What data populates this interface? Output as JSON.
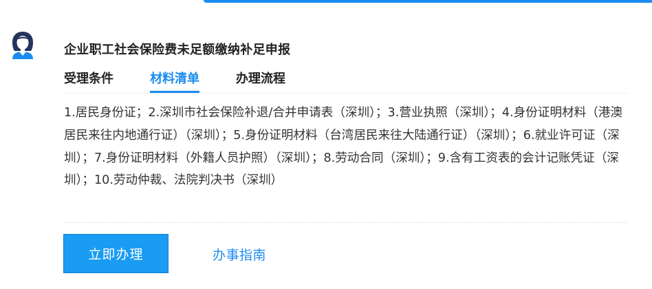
{
  "service": {
    "title": "企业职工社会保险费未足额缴纳补足申报"
  },
  "tabs": [
    {
      "label": "受理条件"
    },
    {
      "label": "材料清单"
    },
    {
      "label": "办理流程"
    }
  ],
  "active_tab": "材料清单",
  "materials": {
    "text": "1.居民身份证；2.深圳市社会保险补退/合并申请表（深圳）；3.营业执照（深圳）；4.身份证明材料（港澳居民来往内地通行证）（深圳）；5.身份证明材料（台湾居民来往大陆通行证）（深圳）；6.就业许可证（深圳）；7.身份证明材料（外籍人员护照）（深圳）；8.劳动合同（深圳）；9.含有工资表的会计记账凭证（深圳）；10.劳动仲裁、法院判决书（深圳）"
  },
  "actions": {
    "apply_label": "立即办理",
    "guide_label": "办事指南"
  },
  "colors": {
    "accent": "#1a8cf0",
    "button_bg": "#1a9cf3",
    "avatar_navy": "#24345c"
  },
  "icons": {
    "avatar": "user-avatar-icon"
  }
}
